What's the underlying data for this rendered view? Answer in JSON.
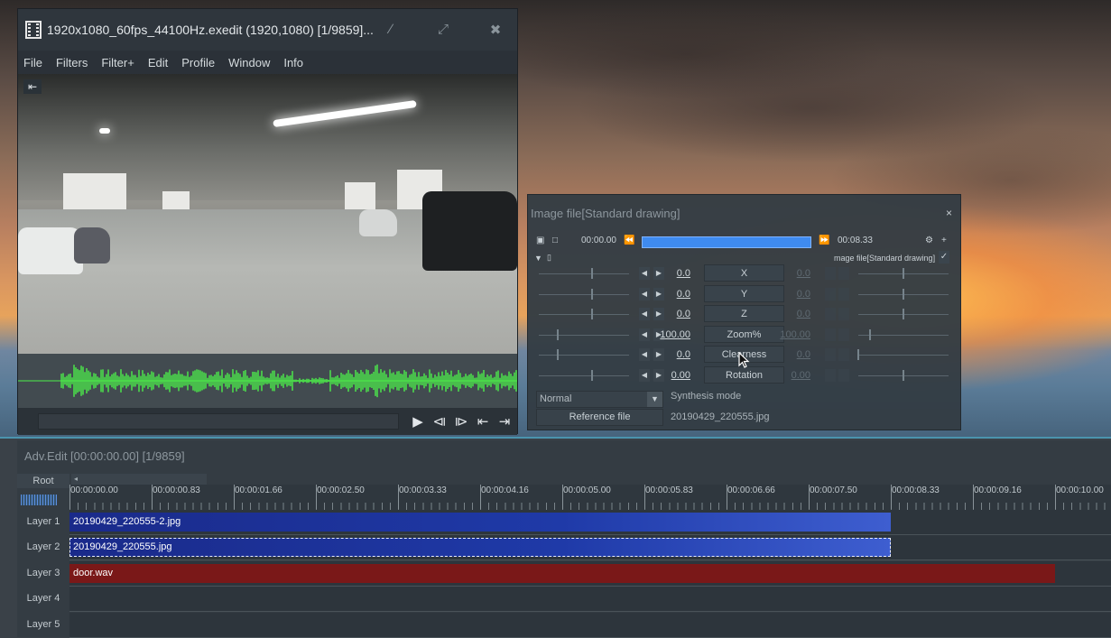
{
  "main_window": {
    "title": "1920x1080_60fps_44100Hz.exedit (1920,1080)  [1/9859]...",
    "menu": [
      "File",
      "Filters",
      "Filter+",
      "Edit",
      "Profile",
      "Window",
      "Info"
    ],
    "controls": [
      "minimize-icon",
      "maximize-icon",
      "close-icon"
    ]
  },
  "prop": {
    "title": "Image file[Standard drawing]",
    "close": "×",
    "start_time": "00:00.00",
    "end_time": "00:08.33",
    "object_name": "mage file[Standard drawing]",
    "params": [
      {
        "name": "X",
        "left": "0.0",
        "right": "0.0"
      },
      {
        "name": "Y",
        "left": "0.0",
        "right": "0.0"
      },
      {
        "name": "Z",
        "left": "0.0",
        "right": "0.0"
      },
      {
        "name": "Zoom%",
        "left": "100.00",
        "right": "100.00"
      },
      {
        "name": "Clearness",
        "left": "0.0",
        "right": "0.0"
      },
      {
        "name": "Rotation",
        "left": "0.00",
        "right": "0.00"
      }
    ],
    "blend_mode": "Normal",
    "synthesis_label": "Synthesis mode",
    "ref_button": "Reference file",
    "ref_file": "20190429_220555.jpg"
  },
  "adv": {
    "title": "Adv.Edit [00:00:00.00] [1/9859]",
    "root": "Root",
    "ticks": [
      "00:00:00.00",
      "00:00:00.83",
      "00:00:01.66",
      "00:00:02.50",
      "00:00:03.33",
      "00:00:04.16",
      "00:00:05.00",
      "00:00:05.83",
      "00:00:06.66",
      "00:00:07.50",
      "00:00:08.33",
      "00:00:09.16",
      "00:00:10.00"
    ],
    "layers": [
      "Layer 1",
      "Layer 2",
      "Layer 3",
      "Layer 4",
      "Layer 5"
    ],
    "clips": [
      {
        "layer": 1,
        "name": "20190429_220555-2.jpg",
        "end_time": "00:00:08.33",
        "color": "#1f3aa8"
      },
      {
        "layer": 2,
        "name": "20190429_220555.jpg",
        "end_time": "00:00:08.33",
        "color": "#1f3aa8",
        "selected": true
      },
      {
        "layer": 3,
        "name": "door.wav",
        "end_time": "00:00:10.00",
        "color": "#7a1818"
      }
    ]
  },
  "colors": {
    "accent": "#3f8bf0",
    "waveform": "#4df04a",
    "audio_clip": "#7a1818"
  }
}
